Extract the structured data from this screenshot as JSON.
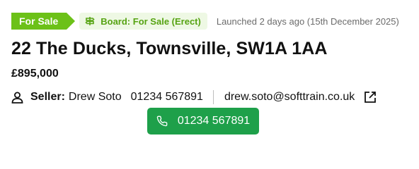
{
  "listing": {
    "status_tag": "For Sale",
    "board_status": "Board: For Sale (Erect)",
    "launched_text": "Launched 2 days ago (15th December 2025)",
    "address": "22 The Ducks, Townsville, SW1A 1AA",
    "price": "£895,000"
  },
  "seller": {
    "label": "Seller:",
    "name": "Drew Soto",
    "phone": "01234 567891",
    "email": "drew.soto@softtrain.co.uk"
  },
  "call_button": {
    "label": "01234 567891"
  },
  "colors": {
    "sale_tag": "#6cc118",
    "board_text": "#56a312",
    "call_button": "#1ea04a"
  },
  "icons": [
    "signpost-icon",
    "person-icon",
    "external-link-icon",
    "phone-icon"
  ]
}
